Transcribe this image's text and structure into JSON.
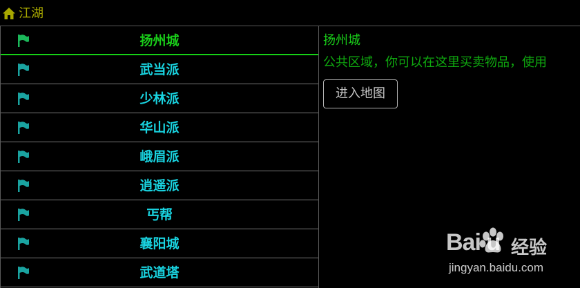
{
  "header": {
    "title": "江湖",
    "icon": "home-icon"
  },
  "colors": {
    "title": "#a8a800",
    "selected_label": "#19cc19",
    "label": "#19d3e0",
    "flag_selected": "#1bb85a",
    "flag": "#1aa3a0",
    "description": "#0fa80f"
  },
  "list": {
    "items": [
      {
        "label": "扬州城",
        "selected": true
      },
      {
        "label": "武当派"
      },
      {
        "label": "少林派"
      },
      {
        "label": "华山派"
      },
      {
        "label": "峨眉派"
      },
      {
        "label": "逍遥派"
      },
      {
        "label": "丐帮"
      },
      {
        "label": "襄阳城"
      },
      {
        "label": "武道塔"
      }
    ]
  },
  "detail": {
    "title": "扬州城",
    "description": "公共区域，你可以在这里买卖物品，使用",
    "enter_button": "进入地图"
  },
  "watermark": {
    "logo_text": "Bai  u",
    "cn": "经验",
    "url": "jingyan.baidu.com"
  }
}
